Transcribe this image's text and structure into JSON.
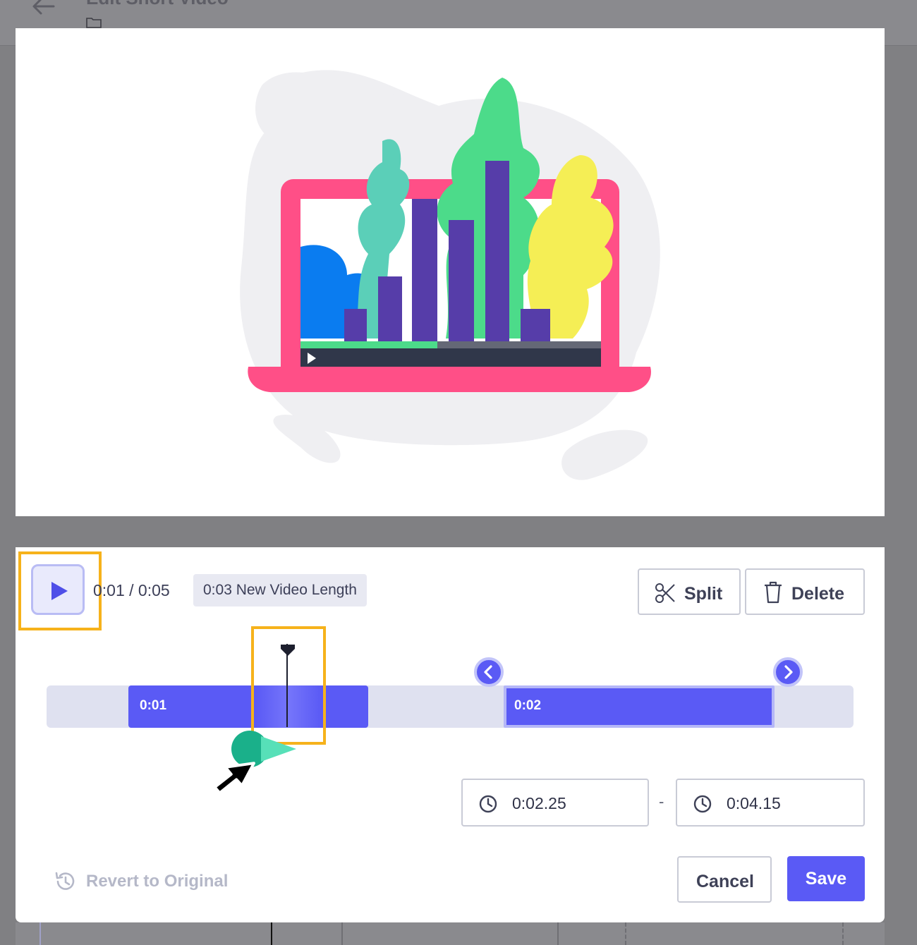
{
  "header": {
    "title": "Edit Short Video"
  },
  "preview": {
    "illustration": "laptop-bar-chart-video-illustration"
  },
  "editor": {
    "time_display": "0:01 / 0:05",
    "new_length_badge": "0:03 New Video Length",
    "split_label": "Split",
    "delete_label": "Delete",
    "clips": [
      {
        "label": "0:01"
      },
      {
        "label": "0:02"
      }
    ],
    "start_time": "0:02.25",
    "end_time": "0:04.15",
    "range_separator": "-",
    "revert_label": "Revert to Original",
    "cancel_label": "Cancel",
    "save_label": "Save"
  },
  "colors": {
    "accent": "#5a5af5",
    "highlight": "#f6b21b",
    "track": "#dfe1f0",
    "overlay": "#808083"
  },
  "icons": [
    "back-arrow-icon",
    "folder-icon",
    "play-icon",
    "scissors-icon",
    "trash-icon",
    "chevron-left-icon",
    "chevron-right-icon",
    "clock-icon",
    "history-icon",
    "mouse-cursor-icon"
  ]
}
